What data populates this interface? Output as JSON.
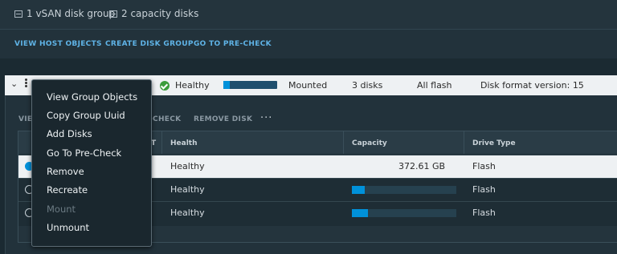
{
  "summary": {
    "disk_groups": "1 vSAN disk group",
    "capacity_disks": "2 capacity disks",
    "disk_group_icon": "disk-group-icon",
    "capacity_icon": "capacity-disks-icon"
  },
  "host_actions": {
    "view_host_objects": "VIEW HOST OBJECTS",
    "create_disk_group": "CREATE DISK GROUP",
    "go_to_precheck": "GO TO PRE-CHECK"
  },
  "disk_group": {
    "health": "Healthy",
    "capacity_used_fraction": 0.12,
    "state": "Mounted",
    "disks": "3 disks",
    "type": "All flash",
    "format": "Disk format version: 15"
  },
  "group_actions": {
    "view": "VIEW",
    "precheck": "-CHECK",
    "remove_disk": "REMOVE DISK",
    "more": "···"
  },
  "table": {
    "headers": {
      "type": "T",
      "health": "Health",
      "capacity": "Capacity",
      "drive_type": "Drive Type"
    },
    "rows": [
      {
        "health": "Healthy",
        "capacity": "372.61 GB",
        "drive_type": "Flash",
        "selected": true
      },
      {
        "health": "Healthy",
        "capacity_fraction": 0.12,
        "drive_type": "Flash",
        "selected": false
      },
      {
        "health": "Healthy",
        "capacity_fraction": 0.15,
        "drive_type": "Flash",
        "selected": false
      }
    ]
  },
  "context_menu": {
    "items": [
      {
        "label": "View Group Objects",
        "enabled": true
      },
      {
        "label": "Copy Group Uuid",
        "enabled": true
      },
      {
        "label": "Add Disks",
        "enabled": true
      },
      {
        "label": "Go To Pre-Check",
        "enabled": true
      },
      {
        "label": "Remove",
        "enabled": true
      },
      {
        "label": "Recreate",
        "enabled": true
      },
      {
        "label": "Mount",
        "enabled": false
      },
      {
        "label": "Unmount",
        "enabled": true
      }
    ]
  },
  "colors": {
    "accent": "#0091da",
    "link": "#5fb3e6",
    "healthy": "#3b9c3b",
    "background": "#1b2a32"
  }
}
